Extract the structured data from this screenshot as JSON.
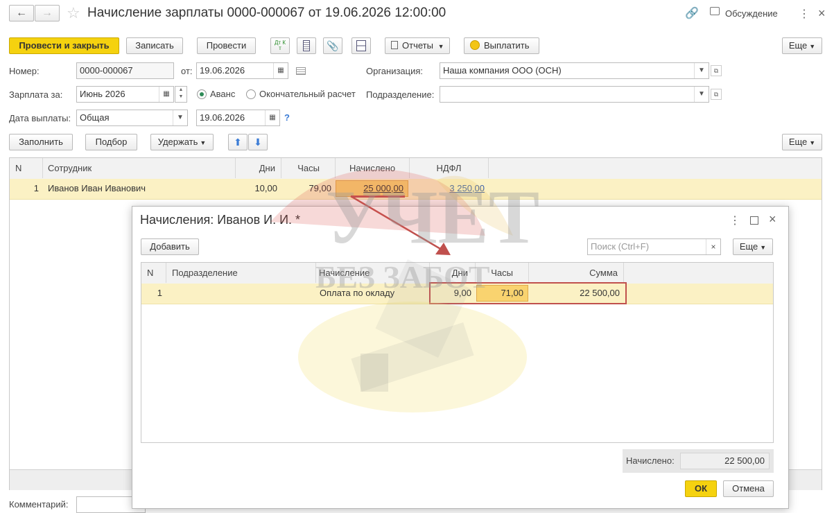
{
  "title": "Начисление зарплаты 0000-000067 от 19.06.2026 12:00:00",
  "discussion": "Обсуждение",
  "toolbar": {
    "post_close": "Провести и закрыть",
    "save": "Записать",
    "post": "Провести",
    "dtkt": "Дт Кт",
    "reports": "Отчеты",
    "pay": "Выплатить",
    "more": "Еще"
  },
  "form": {
    "number_label": "Номер:",
    "number": "0000-000067",
    "from_label": "от:",
    "date": "19.06.2026",
    "org_label": "Организация:",
    "org": "Наша компания ООО (ОСН)",
    "salary_for_label": "Зарплата за:",
    "salary_for": "Июнь 2026",
    "advance": "Аванс",
    "final": "Окончательный расчет",
    "division_label": "Подразделение:",
    "division": "",
    "pay_date_label": "Дата выплаты:",
    "pay_date_type": "Общая",
    "pay_date": "19.06.2026",
    "help": "?"
  },
  "table_toolbar": {
    "fill": "Заполнить",
    "select": "Подбор",
    "withhold": "Удержать",
    "more": "Еще"
  },
  "table": {
    "headers": [
      "N",
      "Сотрудник",
      "Дни",
      "Часы",
      "Начислено",
      "НДФЛ"
    ],
    "rows": [
      {
        "n": "1",
        "employee": "Иванов Иван Иванович",
        "days": "10,00",
        "hours": "79,00",
        "accrued": "25 000,00",
        "ndfl": "3 250,00"
      }
    ]
  },
  "comment_label": "Комментарий:",
  "dialog": {
    "title": "Начисления: Иванов И. И. *",
    "add": "Добавить",
    "search_placeholder": "Поиск (Ctrl+F)",
    "more": "Еще",
    "headers": [
      "N",
      "Подразделение",
      "Начисление",
      "Дни",
      "Часы",
      "Сумма"
    ],
    "rows": [
      {
        "n": "1",
        "division": "",
        "accrual": "Оплата по окладу",
        "days": "9,00",
        "hours": "71,00",
        "sum": "22 500,00"
      }
    ],
    "total_label": "Начислено:",
    "total": "22 500,00",
    "ok": "ОК",
    "cancel": "Отмена"
  },
  "watermark": {
    "line1": "УЧЕТ",
    "line2": "БЕЗ ЗАБОТ"
  },
  "colors": {
    "accent_yellow": "#f5d20f",
    "row_highlight": "#fbf1c4",
    "cell_highlight": "#f9d36f",
    "callout_red": "#c0504d"
  }
}
